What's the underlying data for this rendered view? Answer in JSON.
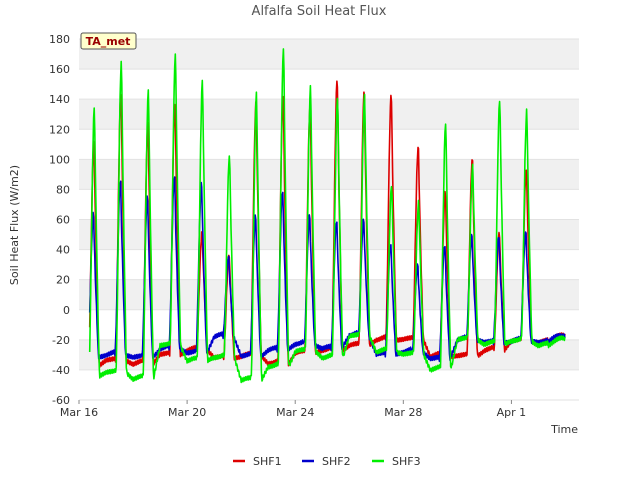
{
  "chart_data": {
    "type": "line",
    "title": "Alfalfa Soil Heat Flux",
    "xlabel": "Time",
    "ylabel": "Soil Heat Flux (W/m2)",
    "badge": "TA_met",
    "ylim": [
      -60,
      180
    ],
    "yticks": [
      -60,
      -40,
      -20,
      0,
      20,
      40,
      60,
      80,
      100,
      120,
      140,
      160,
      180
    ],
    "xlim_days": [
      16.0,
      34.5
    ],
    "xticks": [
      {
        "label": "Mar 16",
        "day": 16
      },
      {
        "label": "Mar 20",
        "day": 20
      },
      {
        "label": "Mar 24",
        "day": 24
      },
      {
        "label": "Mar 28",
        "day": 28
      },
      {
        "label": "Apr 1",
        "day": 32
      }
    ],
    "grid": "horizontal-bands",
    "legend_position": "bottom",
    "colors": {
      "SHF1": "#dd0000",
      "SHF2": "#0000cc",
      "SHF3": "#00ee00"
    },
    "day_points_note": "daily values listed per day for Mar 16 to Apr 2: night minimum (min), daytime peak (peak)",
    "series": [
      {
        "name": "SHF1",
        "min": [
          -37,
          -34,
          -36,
          -30,
          -27,
          -32,
          -31,
          -36,
          -29,
          -27,
          -24,
          -20,
          -20,
          -31,
          -31,
          -27,
          -21,
          -22
        ],
        "peak": [
          113,
          147,
          126,
          140,
          52,
          38,
          140,
          145,
          138,
          155,
          147,
          145,
          110,
          80,
          102,
          52,
          95,
          0
        ]
      },
      {
        "name": "SHF2",
        "min": [
          -32,
          -30,
          -32,
          -26,
          -29,
          -18,
          -31,
          -27,
          -23,
          -26,
          -17,
          -30,
          -28,
          -33,
          -20,
          -22,
          -21,
          -22
        ],
        "peak": [
          65,
          87,
          76,
          90,
          85,
          36,
          63,
          80,
          63,
          60,
          60,
          45,
          30,
          44,
          50,
          50,
          52,
          0
        ]
      },
      {
        "name": "SHF3",
        "min": [
          -44,
          -42,
          -46,
          -24,
          -34,
          -32,
          -47,
          -38,
          -28,
          -32,
          -18,
          -28,
          -30,
          -40,
          -20,
          -23,
          -21,
          -24
        ],
        "peak": [
          135,
          167,
          147,
          172,
          153,
          104,
          145,
          176,
          149,
          143,
          143,
          84,
          72,
          126,
          96,
          141,
          133,
          0
        ]
      }
    ]
  }
}
